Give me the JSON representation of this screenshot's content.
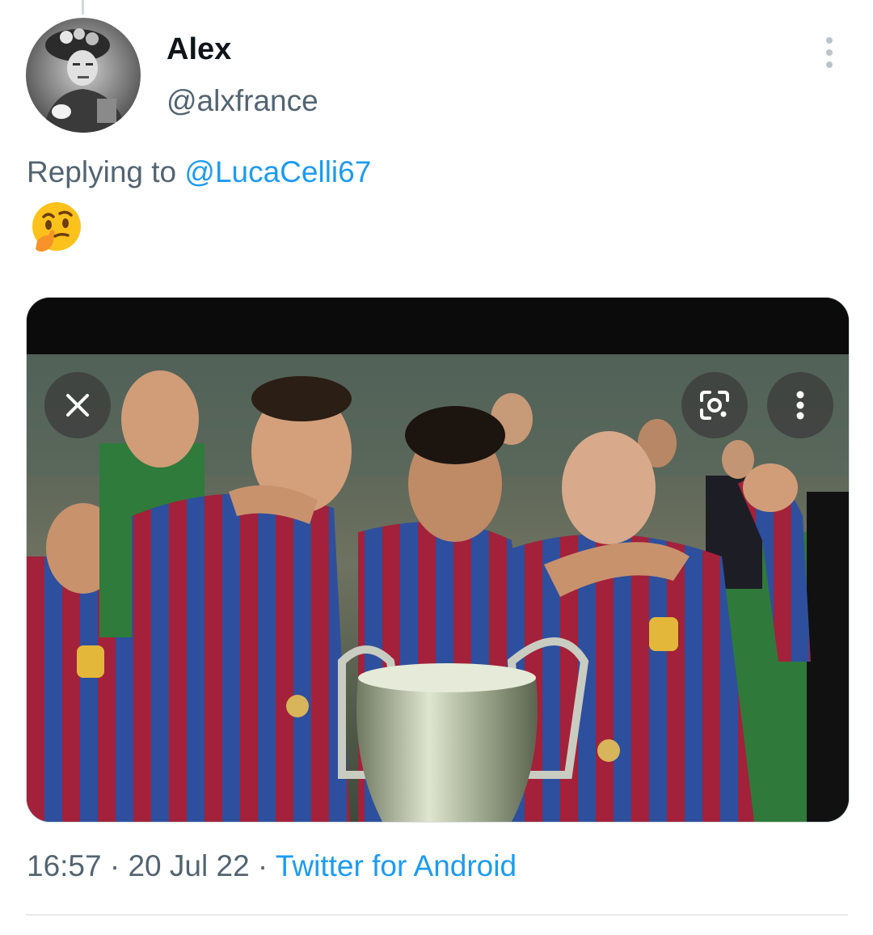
{
  "thread": {
    "connector": true
  },
  "author": {
    "display_name": "Alex",
    "handle": "@alxfrance"
  },
  "reply": {
    "prefix": "Replying to ",
    "mention": "@LucaCelli67"
  },
  "tweet": {
    "emoji": "🤔"
  },
  "media": {
    "close_icon": "close-icon",
    "lens_icon": "lens-icon",
    "more_icon": "more-vertical-icon"
  },
  "meta": {
    "time": "16:57",
    "separator": " · ",
    "date": "20 Jul 22",
    "source": "Twitter for Android"
  },
  "colors": {
    "link": "#1d9bf0",
    "secondary_text": "#536471",
    "primary_text": "#0f1419"
  }
}
